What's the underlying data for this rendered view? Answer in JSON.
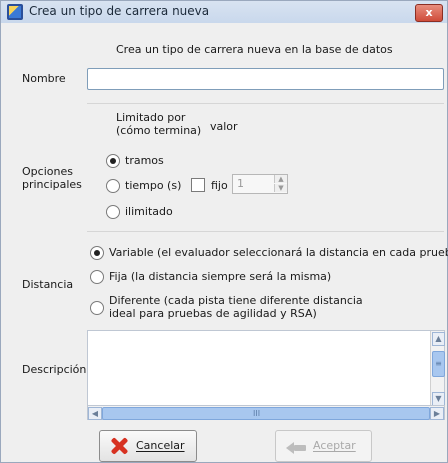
{
  "window": {
    "title": "Crea un tipo de carrera nueva",
    "close_label": "x"
  },
  "subtitle": "Crea un tipo de carrera nueva en la base de datos",
  "labels": {
    "nombre": "Nombre",
    "opciones": [
      "Opciones",
      "principales"
    ],
    "distancia": "Distancia",
    "descripcion": "Descripción"
  },
  "limit": {
    "header1": "Limitado por",
    "header2": "(cómo termina)",
    "valor": "valor"
  },
  "limit_options": [
    {
      "label": "tramos",
      "checked": true
    },
    {
      "label": "tiempo (s)",
      "checked": false
    },
    {
      "label": "ilimitado",
      "checked": false
    }
  ],
  "fixed": {
    "label": "fijo",
    "value": "1",
    "checked": false
  },
  "distance_options": [
    {
      "line1": "Variable (el evaluador seleccionará la distancia en cada prueba)",
      "line2": "",
      "checked": true
    },
    {
      "line1": "Fija (la distancia siempre será la misma)",
      "line2": "",
      "checked": false
    },
    {
      "line1": "Diferente (cada pista tiene diferente distancia",
      "line2": "ideal para pruebas de agilidad y RSA)",
      "checked": false
    }
  ],
  "scroll": {
    "grip": "III",
    "vgrip": "≡"
  },
  "buttons": {
    "cancel": "Cancelar",
    "accept": "Aceptar"
  },
  "colors": {
    "close": "#d3503d",
    "cancel_icon": "#d73222"
  }
}
